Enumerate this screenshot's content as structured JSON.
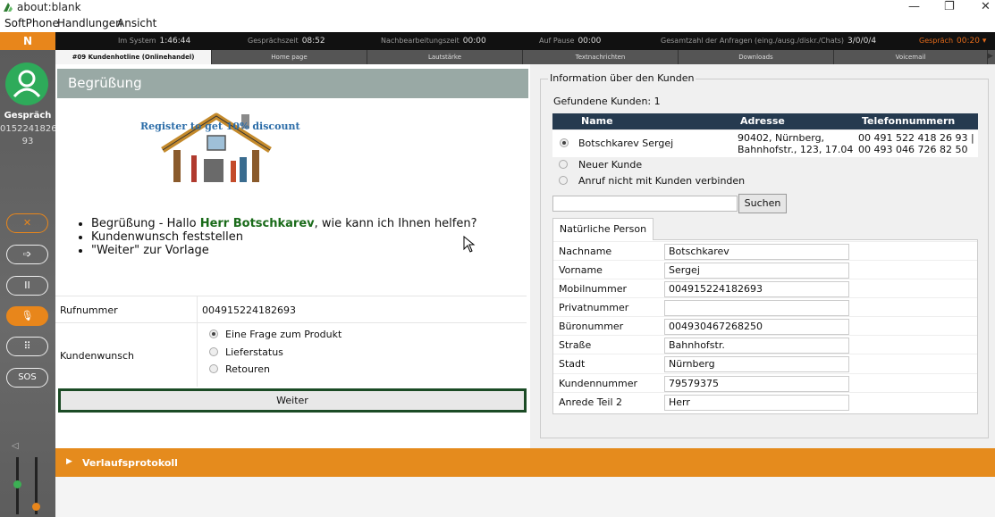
{
  "window": {
    "title": "about:blank",
    "controls": [
      "—",
      "❐",
      "✕"
    ]
  },
  "menubar": [
    "SoftPhone",
    "Handlungen",
    "Ansicht"
  ],
  "sidebar": {
    "logo": "N",
    "status": "Gespräch",
    "number_line1": "0152241826",
    "number_line2": "93",
    "buttons": [
      "✕",
      "➩",
      "II",
      "🎙",
      "⠿",
      "SOS"
    ]
  },
  "statusbar": {
    "im_system_label": "Im System",
    "im_system_value": "1:46:44",
    "gespraechszeit_label": "Gesprächszeit",
    "gespraechszeit_value": "08:52",
    "nachbearbeitung_label": "Nachbearbeitungszeit",
    "nachbearbeitung_value": "00:00",
    "pause_label": "Auf Pause",
    "pause_value": "00:00",
    "anfragen_label": "Gesamtzahl der Anfragen (eing./ausg./diskr./Chats)",
    "anfragen_value": "3/0/0/4",
    "gespraech_label": "Gespräch",
    "gespraech_value": "00:20 ▾"
  },
  "tabs": [
    "#09 Kundenhotline (Onlinehandel)",
    "Home page",
    "Lautstärke",
    "Textnachrichten",
    "Downloads",
    "Voicemail"
  ],
  "left": {
    "heading": "Begrüßung",
    "banner": "Register to get 10% discount",
    "bullet1_pre": "Begrüßung - Hallo ",
    "bullet1_name": "Herr Botschkarev",
    "bullet1_post": ", wie kann ich Ihnen helfen?",
    "bullet2": "Kundenwunsch feststellen",
    "bullet3": "\"Weiter\" zur Vorlage",
    "rufnummer_label": "Rufnummer",
    "rufnummer_value": "004915224182693",
    "kundenwunsch_label": "Kundenwunsch",
    "options": [
      "Eine Frage zum Produkt",
      "Lieferstatus",
      "Retouren"
    ],
    "weiter": "Weiter"
  },
  "right": {
    "legend": "Information über den Kunden",
    "found": "Gefundene Kunden: 1",
    "columns": [
      "Name",
      "Adresse",
      "Telefonnummern"
    ],
    "customer": {
      "name": "Botschkarev Sergej",
      "address1": "90402, Nürnberg,",
      "address2": "Bahnhofstr., 123, 17.04",
      "phone1": "00 491 522 418 26 93 |",
      "phone2": "00 493 046 726 82 50"
    },
    "opt_new": "Neuer Kunde",
    "opt_none": "Anruf nicht mit Kunden verbinden",
    "search_button": "Suchen",
    "person_tab": "Natürliche Person",
    "fields": [
      {
        "label": "Nachname",
        "value": "Botschkarev"
      },
      {
        "label": "Vorname",
        "value": "Sergej"
      },
      {
        "label": "Mobilnummer",
        "value": "004915224182693"
      },
      {
        "label": "Privatnummer",
        "value": ""
      },
      {
        "label": "Büronummer",
        "value": "004930467268250"
      },
      {
        "label": "Straße",
        "value": "Bahnhofstr."
      },
      {
        "label": "Stadt",
        "value": "Nürnberg"
      },
      {
        "label": "Kundennummer",
        "value": "79579375"
      },
      {
        "label": "Anrede Teil 2",
        "value": "Herr"
      }
    ]
  },
  "verlauf": "Verlaufsprotokoll"
}
